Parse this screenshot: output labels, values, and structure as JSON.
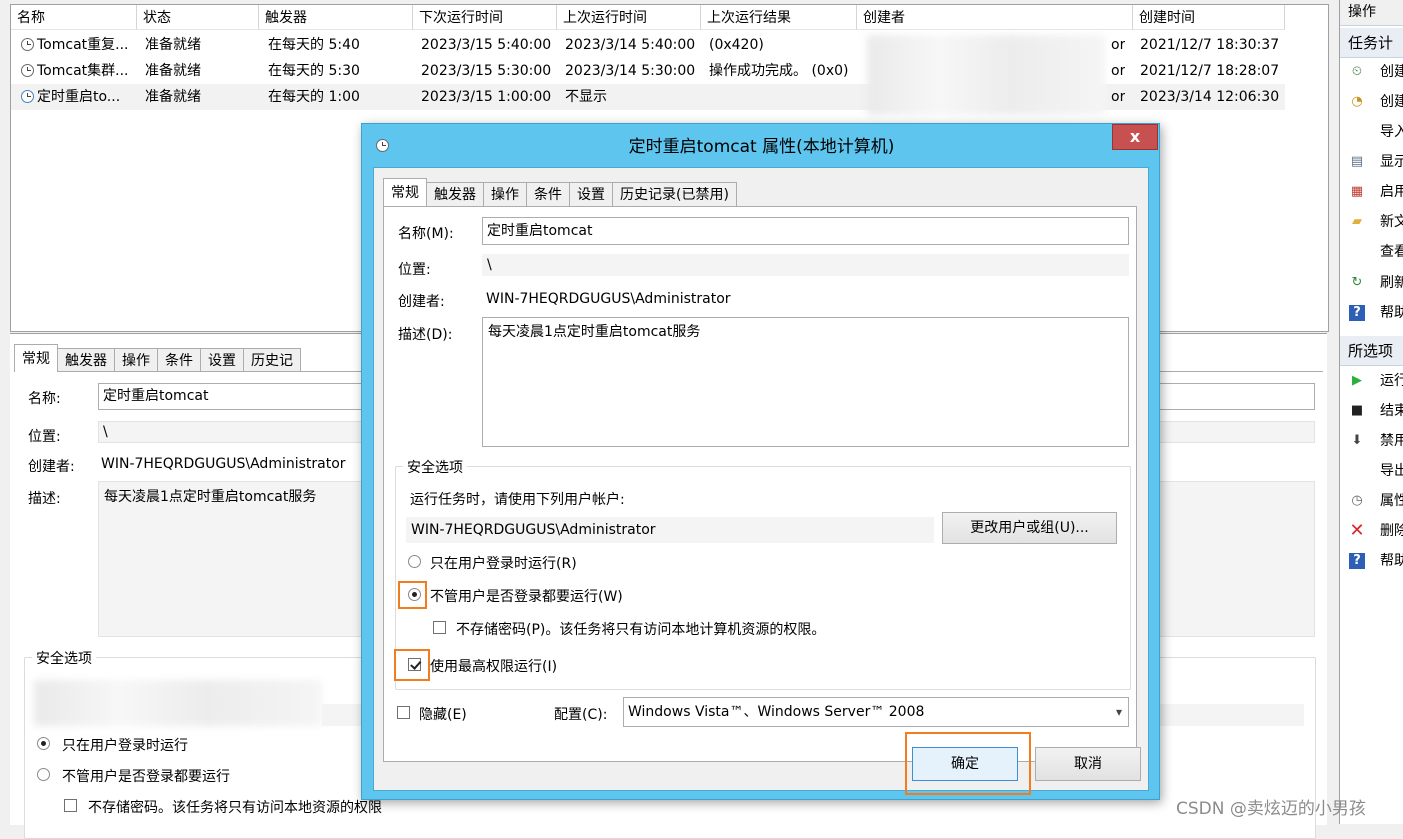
{
  "task_list": {
    "columns": [
      "名称",
      "状态",
      "触发器",
      "下次运行时间",
      "上次运行时间",
      "上次运行结果",
      "创建者",
      "创建时间"
    ],
    "rows": [
      {
        "name": "Tomcat重复...",
        "status": "准备就绪",
        "trigger": "在每天的 5:40",
        "next_run": "2023/3/15 5:40:00",
        "last_run": "2023/3/14 5:40:00",
        "last_result": "(0x420)",
        "creator_tail": "or",
        "created": "2021/12/7 18:30:37"
      },
      {
        "name": "Tomcat集群...",
        "status": "准备就绪",
        "trigger": "在每天的 5:30",
        "next_run": "2023/3/15 5:30:00",
        "last_run": "2023/3/14 5:30:00",
        "last_result": "操作成功完成。 (0x0)",
        "creator_tail": "or",
        "created": "2021/12/7 18:28:07"
      },
      {
        "name": "定时重启to...",
        "status": "准备就绪",
        "trigger": "在每天的 1:00",
        "next_run": "2023/3/15 1:00:00",
        "last_run": "不显示",
        "last_result": "",
        "creator_tail": "or",
        "created": "2023/3/14 12:06:30"
      }
    ]
  },
  "detail_pane": {
    "tabs": [
      "常规",
      "触发器",
      "操作",
      "条件",
      "设置",
      "历史记"
    ],
    "name_label": "名称:",
    "name_value": "定时重启tomcat",
    "location_label": "位置:",
    "location_value": "\\",
    "author_label": "创建者:",
    "author_value": "WIN-7HEQRDGUGUS\\Administrator",
    "desc_label": "描述:",
    "desc_value": "每天凌晨1点定时重启tomcat服务",
    "security_title": "安全选项",
    "radio_logged_on": "只在用户登录时运行",
    "radio_whether": "不管用户是否登录都要运行",
    "chk_no_store": "不存储密码。该任务将只有访问本地资源的权限"
  },
  "actions_pane": {
    "header": "操作",
    "section1": "任务计",
    "items1": [
      {
        "icon": "create-basic-task-icon",
        "label": "创建"
      },
      {
        "icon": "create-task-icon",
        "label": "创建"
      },
      {
        "icon": "",
        "label": "导入"
      },
      {
        "icon": "display-icon",
        "label": "显示"
      },
      {
        "icon": "enable-icon",
        "label": "启用"
      },
      {
        "icon": "new-folder-icon",
        "label": "新文"
      },
      {
        "icon": "",
        "label": "查看"
      },
      {
        "icon": "refresh-icon",
        "label": "刷新"
      },
      {
        "icon": "help-icon",
        "label": "帮助"
      }
    ],
    "section2": "所选项",
    "items2": [
      {
        "icon": "run-icon",
        "label": "运行"
      },
      {
        "icon": "stop-icon",
        "label": "结束"
      },
      {
        "icon": "disable-icon",
        "label": "禁用"
      },
      {
        "icon": "",
        "label": "导出"
      },
      {
        "icon": "properties-icon",
        "label": "属性"
      },
      {
        "icon": "delete-icon",
        "label": "删除"
      },
      {
        "icon": "help-icon",
        "label": "帮助"
      }
    ]
  },
  "dialog": {
    "title": "定时重启tomcat 属性(本地计算机)",
    "close_glyph": "x",
    "tabs": [
      "常规",
      "触发器",
      "操作",
      "条件",
      "设置",
      "历史记录(已禁用)"
    ],
    "name_label": "名称(M):",
    "name_value": "定时重启tomcat",
    "location_label": "位置:",
    "location_value": "\\",
    "author_label": "创建者:",
    "author_value": "WIN-7HEQRDGUGUS\\Administrator",
    "desc_label": "描述(D):",
    "desc_value": "每天凌晨1点定时重启tomcat服务",
    "security_title": "安全选项",
    "run_as_prompt": "运行任务时，请使用下列用户帐户:",
    "run_as_user": "WIN-7HEQRDGUGUS\\Administrator",
    "change_user_button": "更改用户或组(U)...",
    "radio_logged_on": "只在用户登录时运行(R)",
    "radio_whether": "不管用户是否登录都要运行(W)",
    "chk_no_store": "不存储密码(P)。该任务将只有访问本地计算机资源的权限。",
    "chk_highest": "使用最高权限运行(I)",
    "hidden_label": "隐藏(E)",
    "config_label": "配置(C):",
    "config_value": "Windows Vista™、Windows Server™ 2008",
    "ok_button": "确定",
    "cancel_button": "取消"
  },
  "colors": {
    "dialog_frame": "#5ec5ee",
    "close_button": "#c75050",
    "highlight_box": "#f07e1f"
  },
  "watermark": "CSDN @卖炫迈的小男孩"
}
